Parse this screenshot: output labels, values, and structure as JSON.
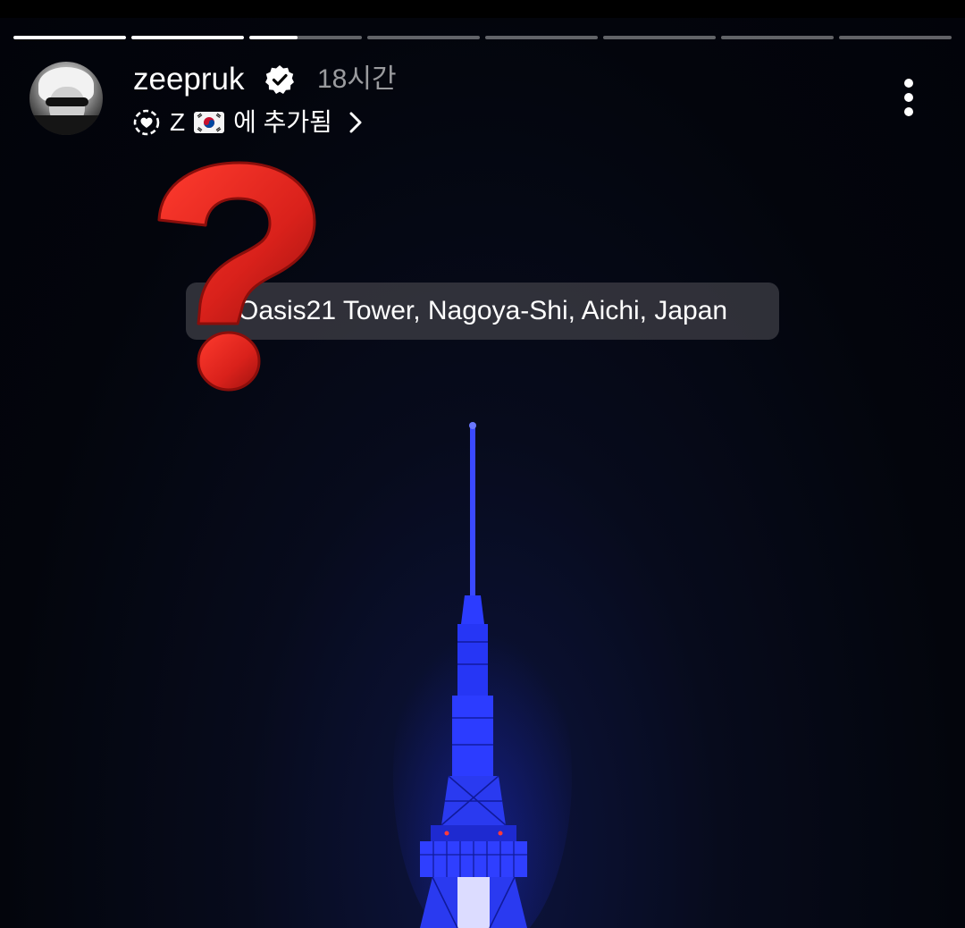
{
  "story": {
    "progress_segments": [
      1,
      1,
      0.43,
      0,
      0,
      0,
      0,
      0
    ],
    "username": "zeepruk",
    "time_ago": "18시간",
    "highlight_prefix": "Z",
    "highlight_suffix": "에 추가됨",
    "icons": {
      "verified": "verified-badge-icon",
      "highlight": "highlight-heart-icon",
      "flag": "south-korea-flag-icon",
      "chevron": "chevron-right-icon",
      "more": "more-options-icon",
      "location": "location-pin-icon"
    }
  },
  "stickers": {
    "question_mark_color": "#d9211b",
    "location_text": "Oasis21 Tower, Nagoya-Shi, Aichi, Japan"
  },
  "scene": {
    "tower_color": "#2c3cff",
    "sky_color": "#03050c"
  }
}
